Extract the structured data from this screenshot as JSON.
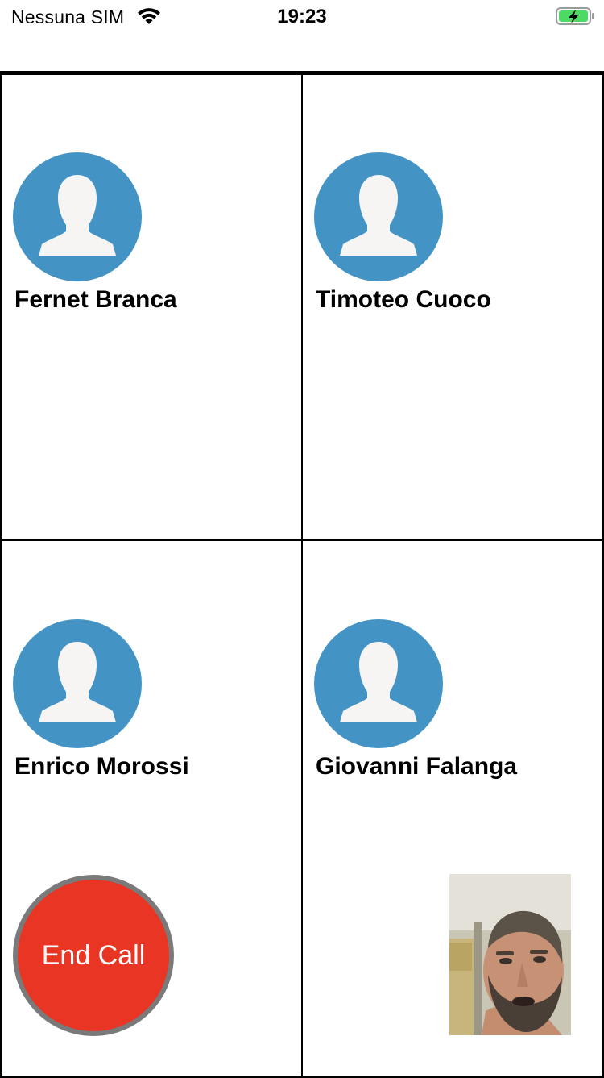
{
  "status_bar": {
    "carrier": "Nessuna SIM",
    "time": "19:23",
    "wifi_icon": "wifi-icon",
    "battery_icon": "battery-charging-icon",
    "battery_color": "#4cd964"
  },
  "participants": [
    {
      "name": "Fernet Branca",
      "avatar_icon": "person-placeholder-icon"
    },
    {
      "name": "Timoteo Cuoco",
      "avatar_icon": "person-placeholder-icon"
    },
    {
      "name": "Enrico Morossi",
      "avatar_icon": "person-placeholder-icon"
    },
    {
      "name": "Giovanni Falanga",
      "avatar_icon": "person-placeholder-icon"
    }
  ],
  "controls": {
    "end_call_label": "End Call",
    "end_call_color": "#e83524",
    "avatar_color": "#4394c4"
  },
  "self_view": {
    "type": "camera-preview"
  }
}
